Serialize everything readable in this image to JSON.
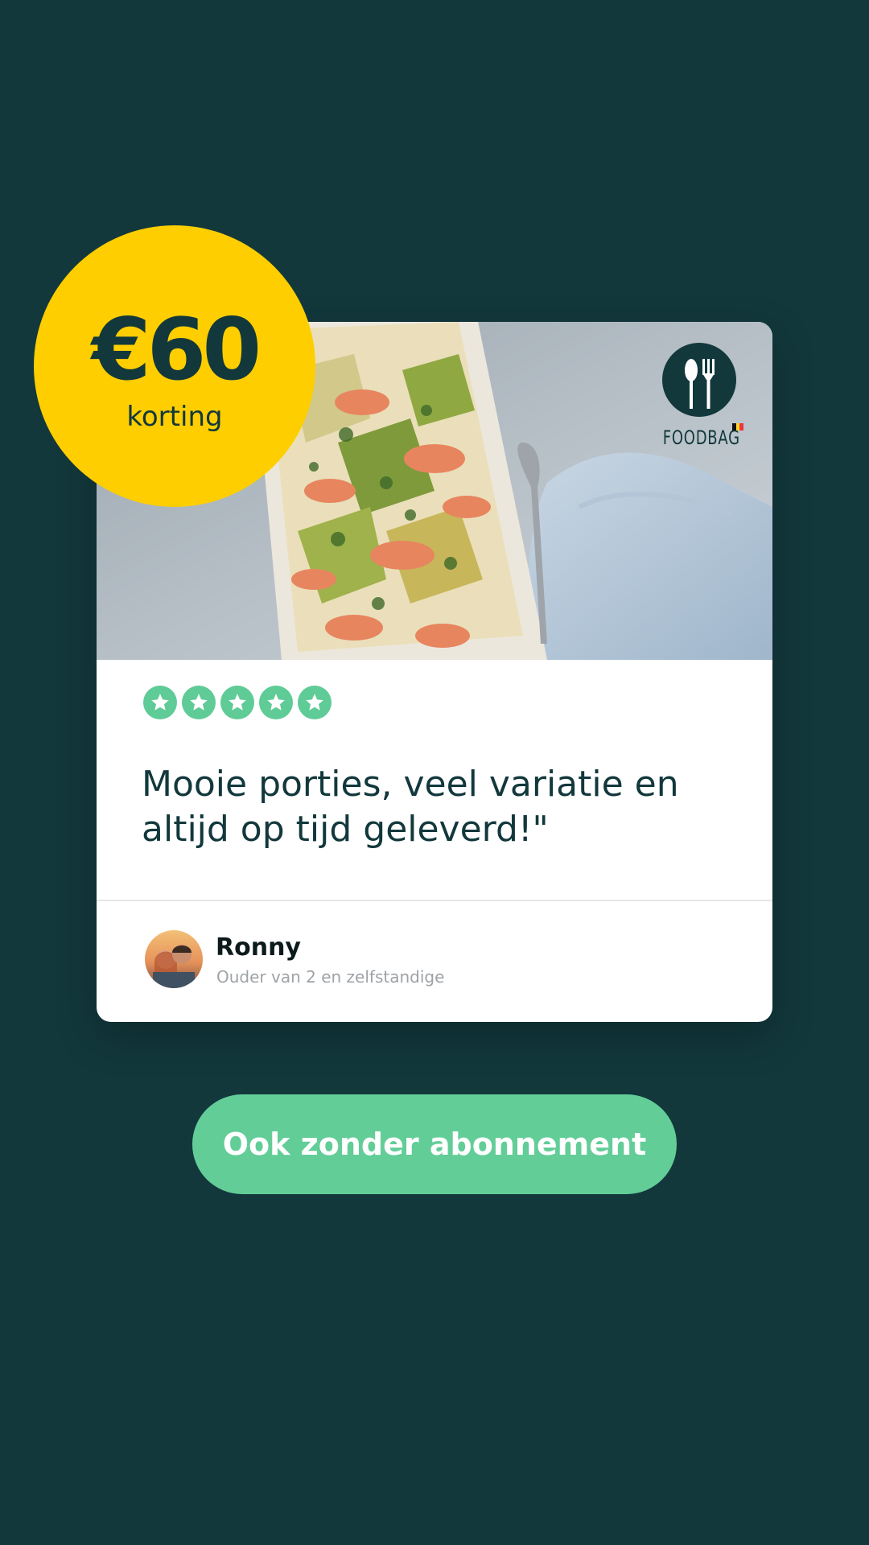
{
  "promo": {
    "amount": "€60",
    "label": "korting"
  },
  "brand": {
    "logo_text": "FOODBAG"
  },
  "review": {
    "rating": 5,
    "quote": "Mooie porties, veel variatie en\naltijd op tijd geleverd!\""
  },
  "author": {
    "name": "Ronny",
    "description": "Ouder van 2 en zelfstandige"
  },
  "cta": {
    "label": "Ook zonder abonnement"
  },
  "colors": {
    "background": "#12383c",
    "badge": "#fece00",
    "accent_green": "#63cd98",
    "card": "#ffffff"
  }
}
